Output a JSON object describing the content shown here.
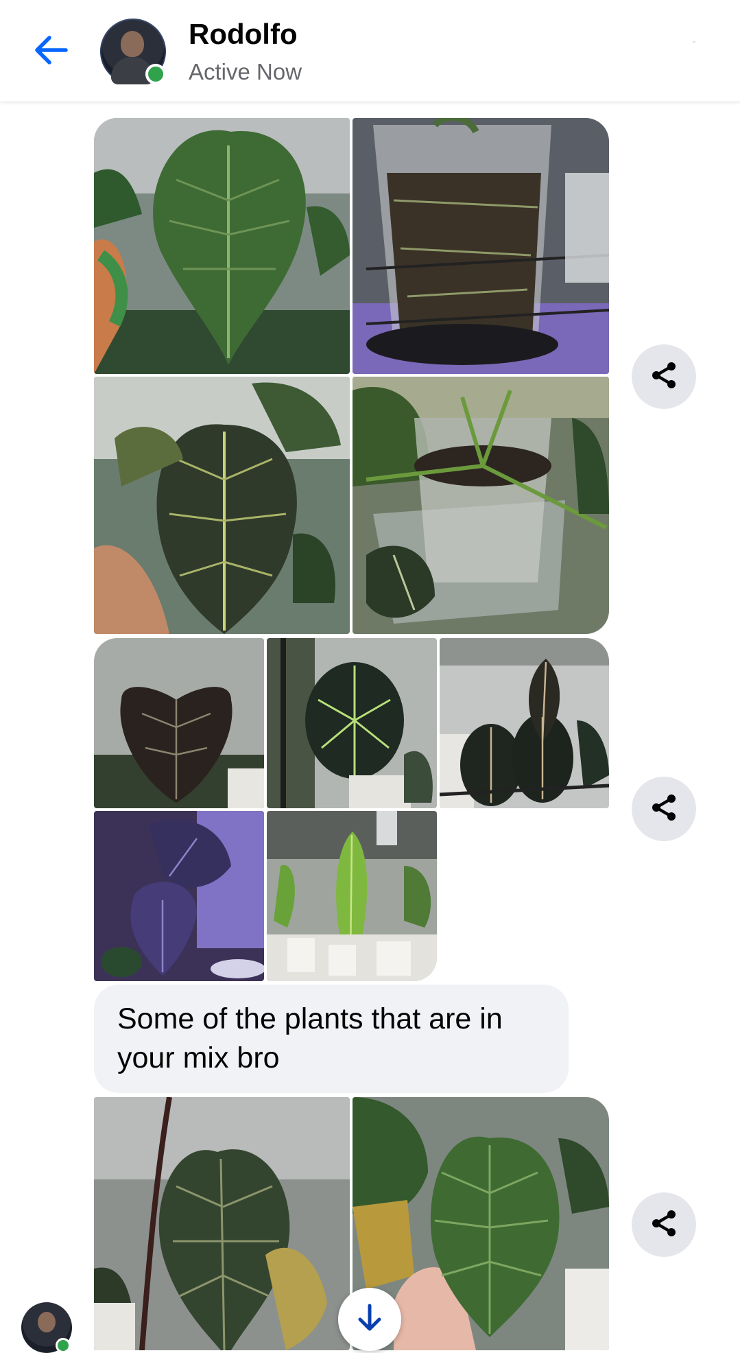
{
  "header": {
    "back_icon": "arrow-left-icon",
    "contact_name": "Rodolfo",
    "contact_status": "Active Now",
    "accent_color": "#0866ff",
    "online_color": "#31a24c"
  },
  "messages": [
    {
      "type": "photo-grid",
      "photos": [
        {
          "description": "Large green heart-shaped leaf held by tattooed arm"
        },
        {
          "description": "Clear pot with soil and roots on wire shelf"
        },
        {
          "description": "Dark velvety leaf with pale veins"
        },
        {
          "description": "Plant in clear pot top view"
        }
      ],
      "share_icon": "share-icon"
    },
    {
      "type": "photo-grid",
      "photos": [
        {
          "description": "Dark leaf with silver veins"
        },
        {
          "description": "Round dark leaf with bright veins"
        },
        {
          "description": "Several dark leaves on shelf"
        },
        {
          "description": "Purple-lit dark leaves"
        },
        {
          "description": "Elongated bright green leaf"
        }
      ],
      "share_icon": "share-icon"
    },
    {
      "type": "text",
      "text": "Some of the plants that are in your mix bro"
    },
    {
      "type": "photo-grid",
      "photos": [
        {
          "description": "Dark green heart leaf in grow tent"
        },
        {
          "description": "Textured green leaf held in hand"
        }
      ],
      "share_icon": "share-icon"
    }
  ],
  "controls": {
    "scroll_down_icon": "arrow-down-icon"
  }
}
